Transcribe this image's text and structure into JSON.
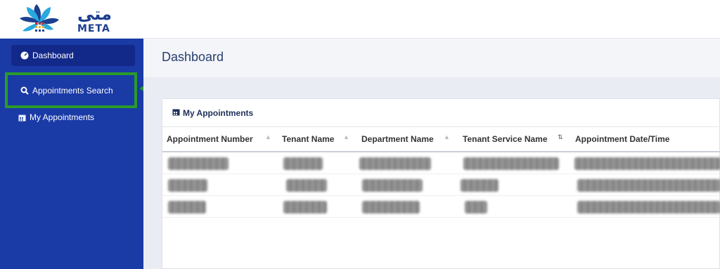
{
  "brand": {
    "name_ar": "متى",
    "name_en": "META",
    "colors": [
      "#1c3f8f",
      "#29a8e0",
      "#d92b2b",
      "#f4a41d",
      "#2a9a2a"
    ]
  },
  "sidebar": {
    "items": [
      {
        "label": "Dashboard",
        "icon": "dashboard-gauge-icon"
      },
      {
        "label": "Appointments Search",
        "icon": "search-icon"
      },
      {
        "label": "My Appointments",
        "icon": "calendar-icon"
      }
    ],
    "highlight_color": "#2a9a2a"
  },
  "page": {
    "title": "Dashboard"
  },
  "card": {
    "title": "My Appointments",
    "icon": "calendar-icon"
  },
  "table": {
    "columns": [
      "Appointment Number",
      "Tenant Name",
      "Department Name",
      "Tenant Service Name",
      "Appointment Date/Time"
    ],
    "sorted_column_index": 3,
    "row_count": 3,
    "cells_redacted": true
  }
}
